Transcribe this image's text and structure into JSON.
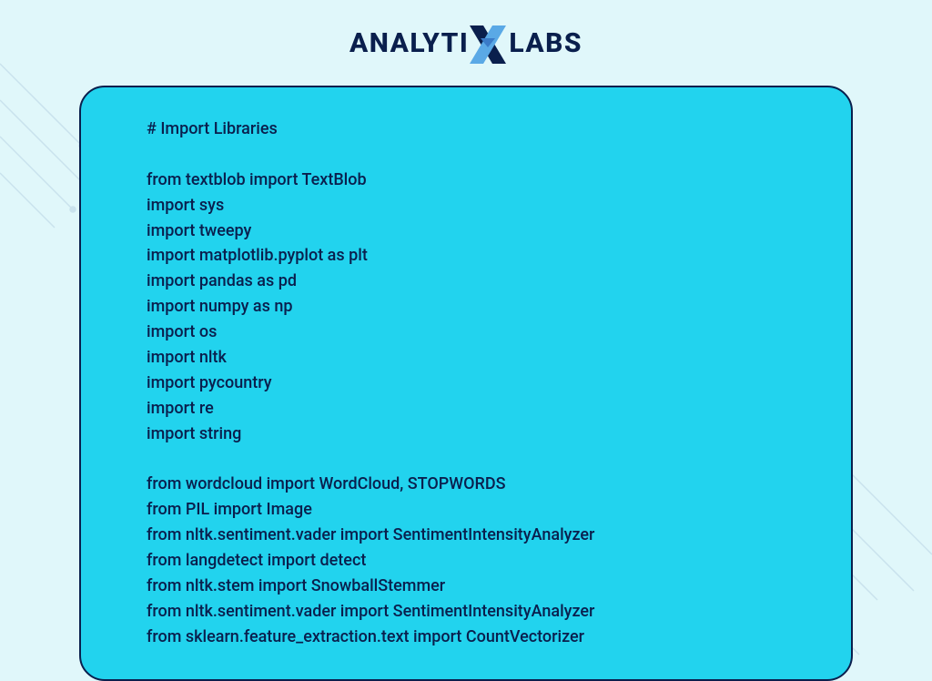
{
  "logo": {
    "text_left": "ANALYTI",
    "text_right": "LABS"
  },
  "code": {
    "header_comment": "# Import Libraries",
    "lines": [
      "",
      "from textblob import TextBlob",
      "import sys",
      "import tweepy",
      "import matplotlib.pyplot as plt",
      "import pandas as pd",
      "import numpy as np",
      "import os",
      "import nltk",
      "import pycountry",
      "import re",
      "import string",
      "",
      "from wordcloud import WordCloud, STOPWORDS",
      "from PIL import Image",
      "from nltk.sentiment.vader import SentimentIntensityAnalyzer",
      "from langdetect import detect",
      "from nltk.stem import SnowballStemmer",
      "from nltk.sentiment.vader import SentimentIntensityAnalyzer",
      "from sklearn.feature_extraction.text import CountVectorizer"
    ]
  }
}
